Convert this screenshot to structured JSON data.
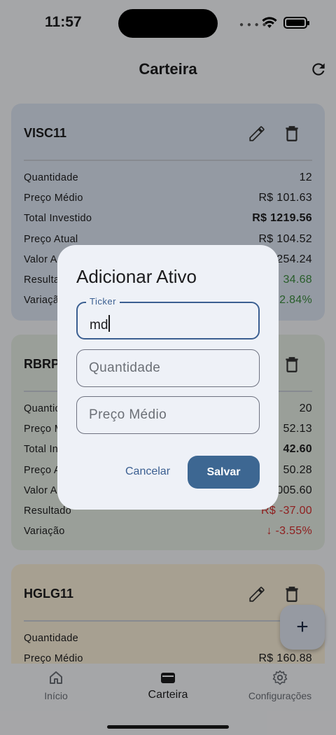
{
  "status_bar": {
    "time": "11:57"
  },
  "header": {
    "title": "Carteira",
    "refresh_icon": "refresh-icon"
  },
  "colors": {
    "card_blue": "#dbe3f0",
    "card_green": "#e3ebe2",
    "card_yellow": "#f7ecd6",
    "accent": "#3d6792",
    "positive": "#3b8a3e",
    "negative": "#d32f2f"
  },
  "cards": [
    {
      "ticker": "VISC11",
      "rows": [
        {
          "label": "Quantidade",
          "value": "12"
        },
        {
          "label": "Preço Médio",
          "value": "R$ 101.63"
        },
        {
          "label": "Total Investido",
          "value": "R$ 1219.56"
        },
        {
          "label": "Preço Atual",
          "value": "R$ 104.52"
        },
        {
          "label": "Valor A",
          "value": "254.24"
        },
        {
          "label": "Resulta",
          "value": "34.68"
        },
        {
          "label": "Variaçã",
          "value": "2.84%"
        }
      ]
    },
    {
      "ticker": "RBRP",
      "rows": [
        {
          "label": "Quantic",
          "value": "20"
        },
        {
          "label": "Preço M",
          "value": "52.13"
        },
        {
          "label": "Total In",
          "value": "42.60"
        },
        {
          "label": "Preço A",
          "value": "50.28"
        },
        {
          "label": "Valor A",
          "value": "005.60"
        },
        {
          "label": "Resultado",
          "value": "R$ -37.00"
        },
        {
          "label": "Variação",
          "value": "↓ -3.55%"
        }
      ]
    },
    {
      "ticker": "HGLG11",
      "rows": [
        {
          "label": "Quantidade",
          "value": ""
        },
        {
          "label": "Preço Médio",
          "value": "R$ 160.88"
        }
      ]
    }
  ],
  "fab": {
    "label": "+"
  },
  "bottom_nav": {
    "items": [
      {
        "label": "Início",
        "icon": "home-icon"
      },
      {
        "label": "Carteira",
        "icon": "wallet-icon"
      },
      {
        "label": "Configurações",
        "icon": "gear-icon"
      }
    ],
    "active": "Carteira"
  },
  "dialog": {
    "title": "Adicionar Ativo",
    "ticker_label": "Ticker",
    "ticker_value": "md",
    "quantity_placeholder": "Quantidade",
    "price_placeholder": "Preço Médio",
    "cancel_label": "Cancelar",
    "save_label": "Salvar"
  }
}
